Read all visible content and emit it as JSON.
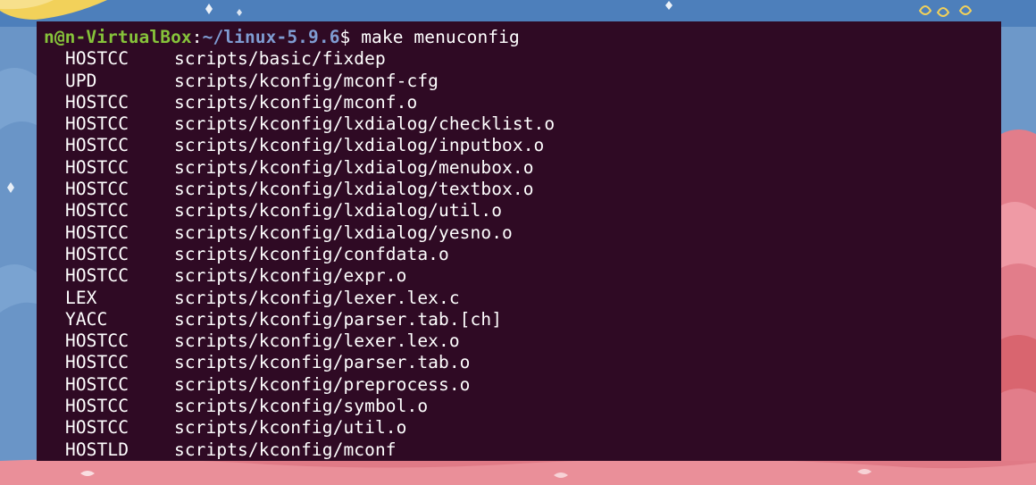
{
  "terminal": {
    "prompt": {
      "user_host": "n@n-VirtualBox",
      "colon": ":",
      "path": "~/linux-5.9.6",
      "dollar": "$",
      "command": " make menuconfig"
    },
    "lines": [
      {
        "tag": "HOSTCC",
        "path": "scripts/basic/fixdep"
      },
      {
        "tag": "UPD",
        "path": "scripts/kconfig/mconf-cfg"
      },
      {
        "tag": "HOSTCC",
        "path": "scripts/kconfig/mconf.o"
      },
      {
        "tag": "HOSTCC",
        "path": "scripts/kconfig/lxdialog/checklist.o"
      },
      {
        "tag": "HOSTCC",
        "path": "scripts/kconfig/lxdialog/inputbox.o"
      },
      {
        "tag": "HOSTCC",
        "path": "scripts/kconfig/lxdialog/menubox.o"
      },
      {
        "tag": "HOSTCC",
        "path": "scripts/kconfig/lxdialog/textbox.o"
      },
      {
        "tag": "HOSTCC",
        "path": "scripts/kconfig/lxdialog/util.o"
      },
      {
        "tag": "HOSTCC",
        "path": "scripts/kconfig/lxdialog/yesno.o"
      },
      {
        "tag": "HOSTCC",
        "path": "scripts/kconfig/confdata.o"
      },
      {
        "tag": "HOSTCC",
        "path": "scripts/kconfig/expr.o"
      },
      {
        "tag": "LEX",
        "path": "scripts/kconfig/lexer.lex.c"
      },
      {
        "tag": "YACC",
        "path": "scripts/kconfig/parser.tab.[ch]"
      },
      {
        "tag": "HOSTCC",
        "path": "scripts/kconfig/lexer.lex.o"
      },
      {
        "tag": "HOSTCC",
        "path": "scripts/kconfig/parser.tab.o"
      },
      {
        "tag": "HOSTCC",
        "path": "scripts/kconfig/preprocess.o"
      },
      {
        "tag": "HOSTCC",
        "path": "scripts/kconfig/symbol.o"
      },
      {
        "tag": "HOSTCC",
        "path": "scripts/kconfig/util.o"
      },
      {
        "tag": "HOSTLD",
        "path": "scripts/kconfig/mconf"
      }
    ]
  },
  "colors": {
    "terminal_bg": "#2f0a24",
    "prompt_user": "#86c33a",
    "prompt_path": "#7f9cd2",
    "text": "#ffffff"
  }
}
